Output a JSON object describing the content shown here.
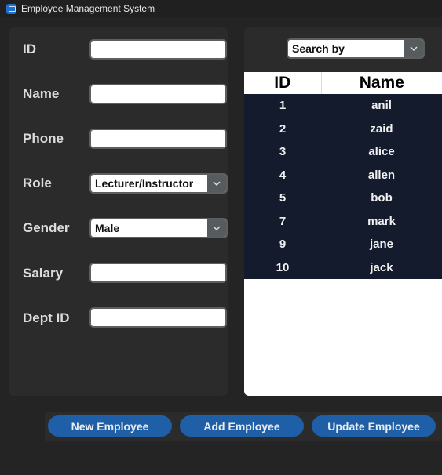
{
  "window": {
    "title": "Employee Management System"
  },
  "form": {
    "id_label": "ID",
    "id_value": "",
    "name_label": "Name",
    "name_value": "",
    "phone_label": "Phone",
    "phone_value": "",
    "role_label": "Role",
    "role_value": "Lecturer/Instructor",
    "gender_label": "Gender",
    "gender_value": "Male",
    "salary_label": "Salary",
    "salary_value": "",
    "dept_label": "Dept ID",
    "dept_value": ""
  },
  "search": {
    "value": "Search by"
  },
  "table": {
    "columns": [
      "ID",
      "Name"
    ],
    "rows": [
      [
        "1",
        "anil"
      ],
      [
        "2",
        "zaid"
      ],
      [
        "3",
        "alice"
      ],
      [
        "4",
        "allen"
      ],
      [
        "5",
        "bob"
      ],
      [
        "7",
        "mark"
      ],
      [
        "9",
        "jane"
      ],
      [
        "10",
        "jack"
      ]
    ]
  },
  "buttons": {
    "new_label": "New Employee",
    "add_label": "Add Employee",
    "update_label": "Update Employee"
  },
  "colors": {
    "background": "#242424",
    "panel": "#2b2b2b",
    "accent": "#1f5fa8",
    "table_body": "#141b2d"
  },
  "icons": {
    "app": "app-window-icon",
    "dropdown": "chevron-down-icon"
  }
}
